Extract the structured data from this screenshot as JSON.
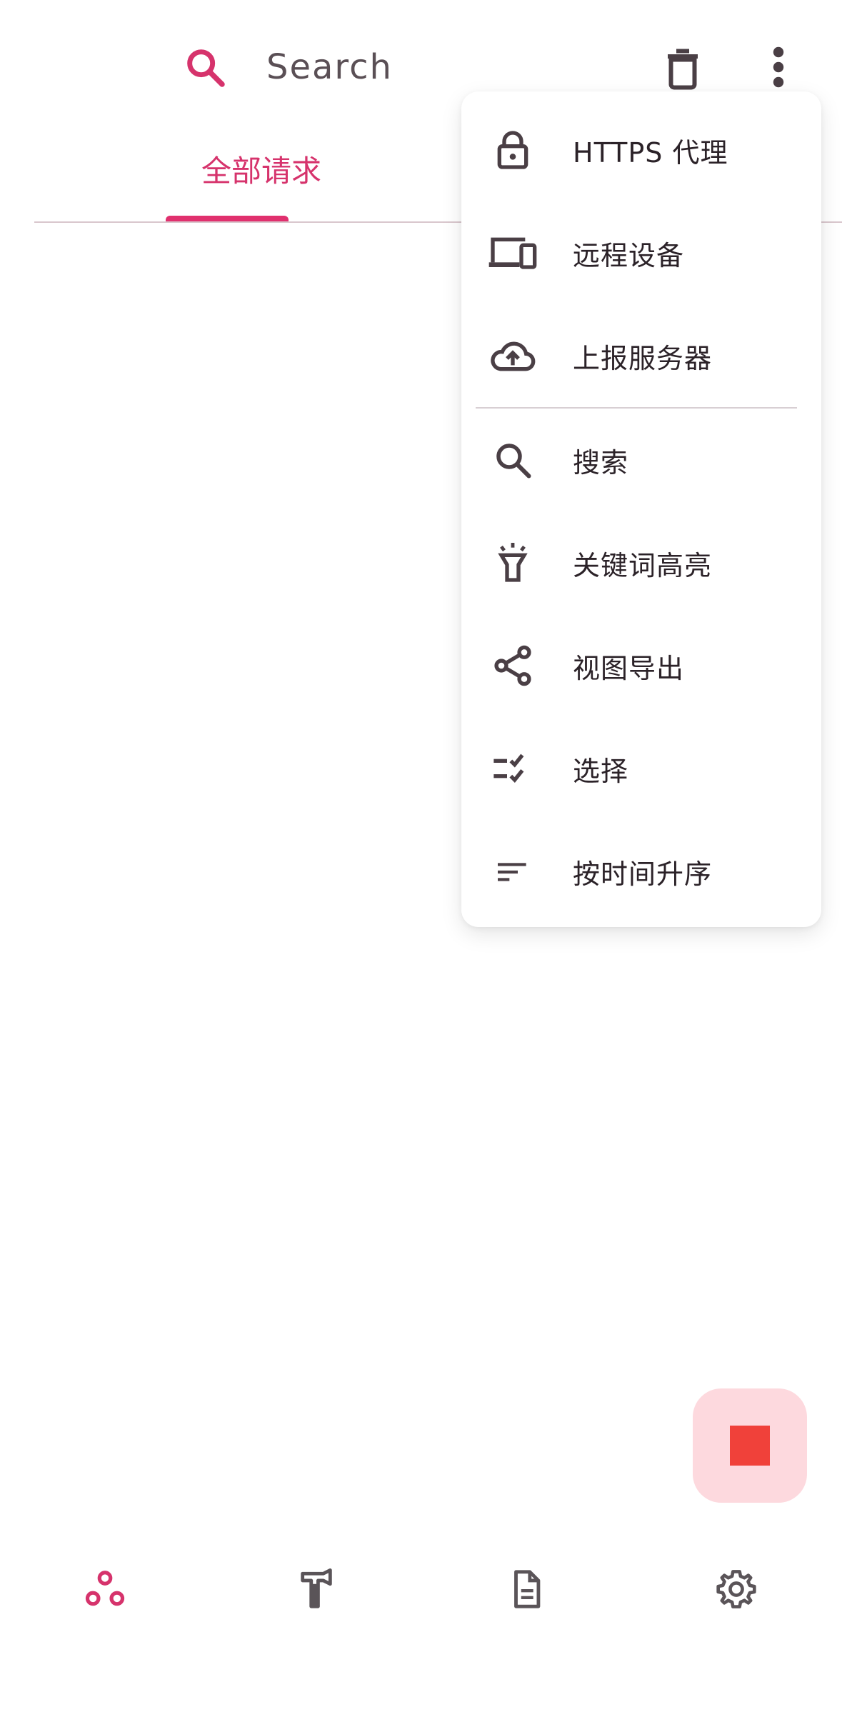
{
  "topbar": {
    "search_placeholder": "Search",
    "search_icon": "search-icon",
    "delete_icon": "delete-icon",
    "more_icon": "more-vert-icon"
  },
  "tabs": {
    "active_label": "全部请求"
  },
  "menu": {
    "items": [
      {
        "label": "HTTPS 代理",
        "icon": "lock-icon"
      },
      {
        "label": "远程设备",
        "icon": "devices-icon"
      },
      {
        "label": "上报服务器",
        "icon": "cloud-upload-icon"
      },
      {
        "label": "搜索",
        "icon": "search-icon"
      },
      {
        "label": "关键词高亮",
        "icon": "highlight-icon"
      },
      {
        "label": "视图导出",
        "icon": "share-icon"
      },
      {
        "label": "选择",
        "icon": "checklist-icon"
      },
      {
        "label": "按时间升序",
        "icon": "sort-icon"
      }
    ]
  },
  "fab": {
    "icon": "stop-icon"
  },
  "bottom_nav": {
    "items": [
      {
        "icon": "network-icon",
        "active": true
      },
      {
        "icon": "toolbox-icon",
        "active": false
      },
      {
        "icon": "document-icon",
        "active": false
      },
      {
        "icon": "settings-icon",
        "active": false
      }
    ]
  },
  "colors": {
    "accent": "#d6336c",
    "fab_bg": "#fdd9de",
    "fab_stop": "#f0413a",
    "icon_dark": "#4a3f45"
  }
}
